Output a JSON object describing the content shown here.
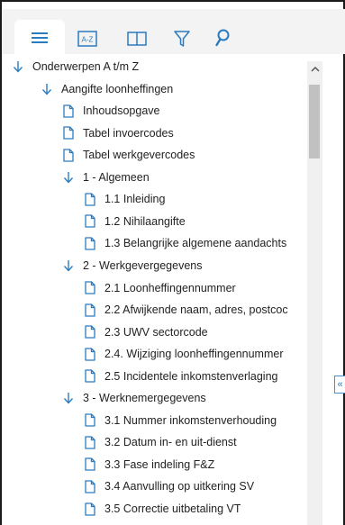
{
  "colors": {
    "accent": "#2b7bbf",
    "text": "#222222"
  },
  "toolbar": {
    "tabs": [
      {
        "name": "contents-tab",
        "icon": "list-icon"
      },
      {
        "name": "index-tab",
        "icon": "a-z-icon",
        "label": "A-Z"
      },
      {
        "name": "book-tab",
        "icon": "book-icon"
      },
      {
        "name": "filter-tab",
        "icon": "filter-icon"
      },
      {
        "name": "search-tab",
        "icon": "search-icon"
      }
    ]
  },
  "tree": {
    "items": [
      {
        "label": "Onderwerpen A t/m Z",
        "type": "folder",
        "level": 0
      },
      {
        "label": "Aangifte loonheffingen",
        "type": "folder",
        "level": 1
      },
      {
        "label": "Inhoudsopgave",
        "type": "page",
        "level": 2
      },
      {
        "label": "Tabel invoercodes",
        "type": "page",
        "level": 2
      },
      {
        "label": "Tabel werkgevercodes",
        "type": "page",
        "level": 2
      },
      {
        "label": "1 - Algemeen",
        "type": "folder",
        "level": 2
      },
      {
        "label": "1.1 Inleiding",
        "type": "page",
        "level": 3
      },
      {
        "label": "1.2 Nihilaangifte",
        "type": "page",
        "level": 3
      },
      {
        "label": "1.3 Belangrijke algemene aandachts",
        "type": "page",
        "level": 3
      },
      {
        "label": "2 - Werkgevergegevens",
        "type": "folder",
        "level": 2
      },
      {
        "label": "2.1 Loonheffingennummer",
        "type": "page",
        "level": 3
      },
      {
        "label": "2.2 Afwijkende naam, adres, postcoc",
        "type": "page",
        "level": 3
      },
      {
        "label": "2.3 UWV sectorcode",
        "type": "page",
        "level": 3
      },
      {
        "label": "2.4. Wijziging loonheffingennummer",
        "type": "page",
        "level": 3
      },
      {
        "label": "2.5 Incidentele inkomstenverlaging",
        "type": "page",
        "level": 3
      },
      {
        "label": "3 - Werknemergegevens",
        "type": "folder",
        "level": 2
      },
      {
        "label": "3.1 Nummer inkomstenverhouding",
        "type": "page",
        "level": 3
      },
      {
        "label": "3.2 Datum in- en uit-dienst",
        "type": "page",
        "level": 3
      },
      {
        "label": "3.3 Fase indeling F&Z",
        "type": "page",
        "level": 3
      },
      {
        "label": "3.4 Aanvulling op uitkering SV",
        "type": "page",
        "level": 3
      },
      {
        "label": "3.5 Correctie uitbetaling VT",
        "type": "page",
        "level": 3
      }
    ]
  },
  "collapse_glyph": "«"
}
